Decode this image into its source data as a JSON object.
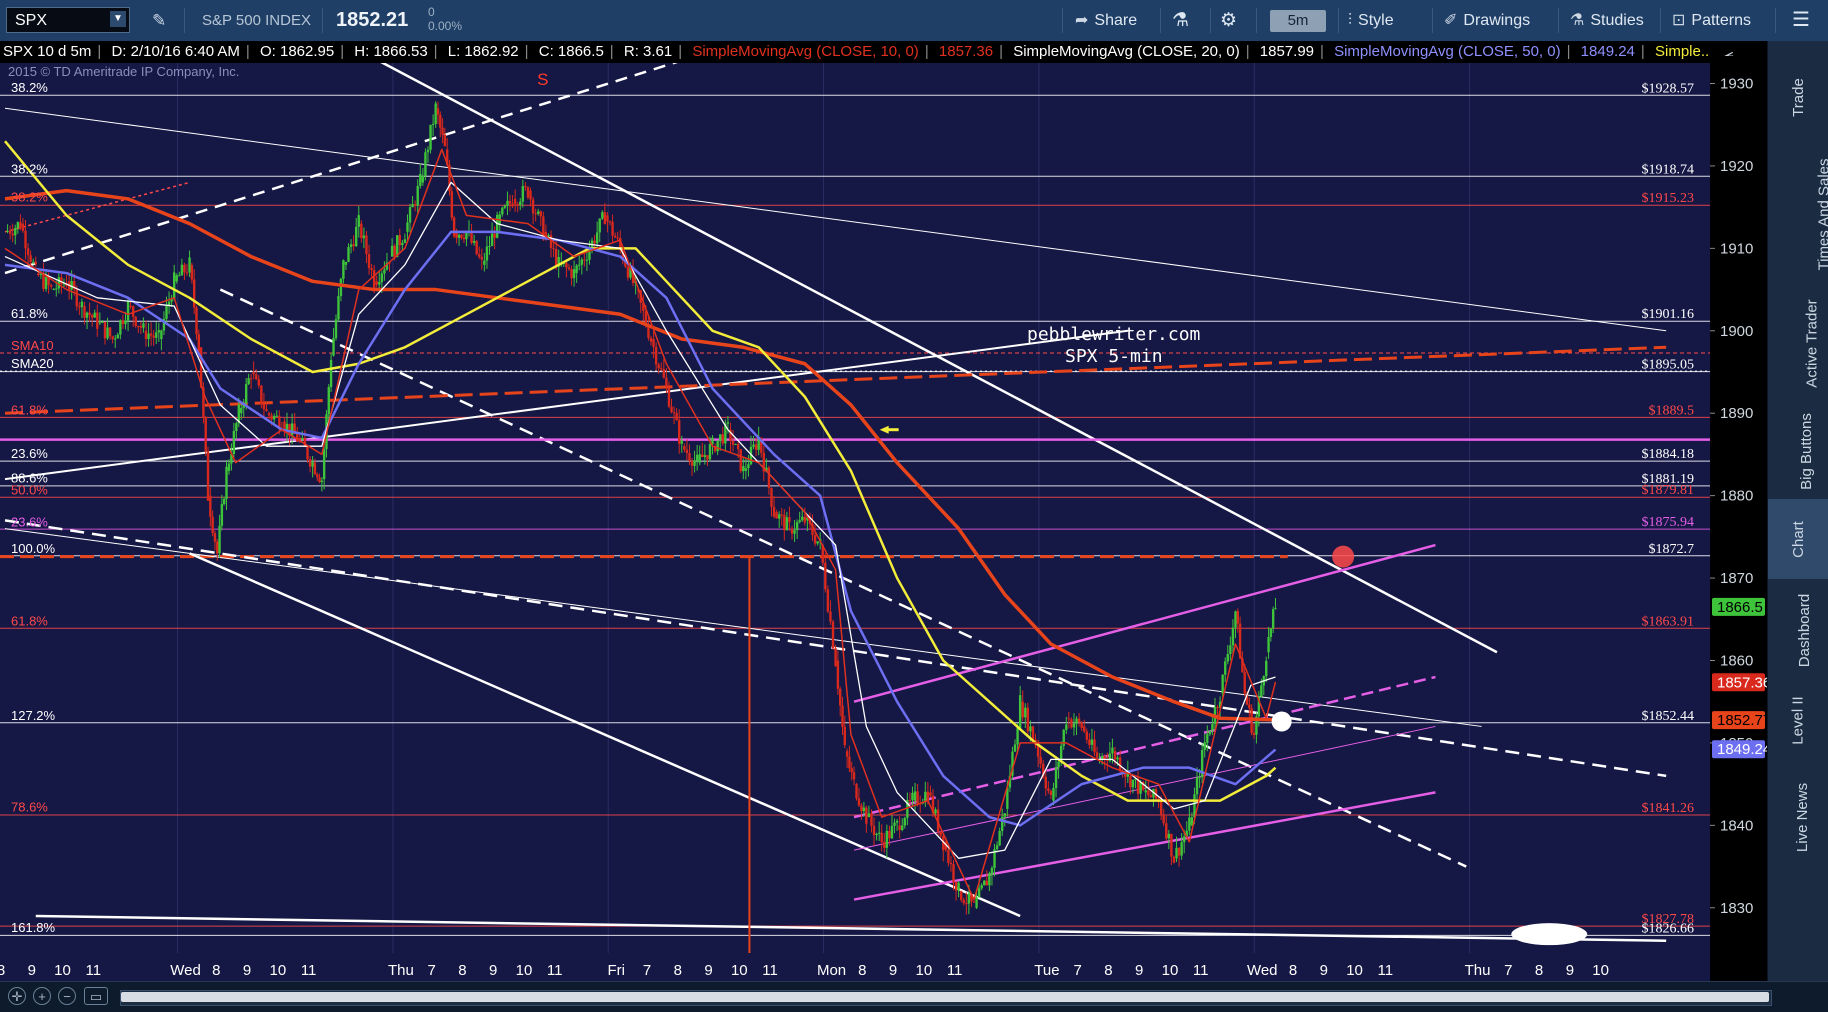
{
  "toolbar": {
    "symbol": "SPX",
    "description": "S&P 500 INDEX",
    "last_price": "1852.21",
    "change": "0",
    "change_pct": "0.00%",
    "share": "Share",
    "timeframe": "5m",
    "style": "Style",
    "drawings": "Drawings",
    "studies": "Studies",
    "patterns": "Patterns"
  },
  "status": {
    "chart_id": "SPX 10 d 5m",
    "date": "D: 2/10/16 6:40 AM",
    "open": "O: 1862.95",
    "high": "H: 1866.53",
    "low": "L: 1862.92",
    "close": "C: 1866.5",
    "range": "R: 3.61",
    "sma10_label": "SimpleMovingAvg (CLOSE, 10, 0)",
    "sma10_val": "1857.36",
    "sma20_label": "SimpleMovingAvg (CLOSE, 20, 0)",
    "sma20_val": "1857.99",
    "sma50_label": "SimpleMovingAvg (CLOSE, 50, 0)",
    "sma50_val": "1849.24",
    "more": "Simple..."
  },
  "colors": {
    "background": "#151744",
    "sma10": "#e0311f",
    "sma20": "#ffffff",
    "sma50": "#6d6ff2",
    "sma_yellow": "#f2ec3a",
    "magenta": "#e45ee6",
    "orange_red": "#e8441c",
    "up": "#3ec43a",
    "down": "#d9281c"
  },
  "chart": {
    "copyright": "2015 © TD Ameritrade IP Company, Inc.",
    "marker_s": "S",
    "watermark_1": "pebblewriter.com",
    "watermark_2": "SPX 5-min",
    "fib_labels": [
      {
        "text": "38.2%",
        "price": 1928.6,
        "color": "#ffffff"
      },
      {
        "text": "38.2%",
        "price": 1918.7,
        "color": "#ffffff"
      },
      {
        "text": "38.2%",
        "price": 1915.3,
        "color": "#ff4a4a"
      },
      {
        "text": "61.8%",
        "price": 1901.2,
        "color": "#ffffff"
      },
      {
        "text": "SMA10",
        "price": 1897.3,
        "color": "#ff4a4a"
      },
      {
        "text": "SMA20",
        "price": 1895.1,
        "color": "#ffffff"
      },
      {
        "text": "61.8%",
        "price": 1889.5,
        "color": "#ff4a4a"
      },
      {
        "text": "23.6%",
        "price": 1884.2,
        "color": "#ffffff"
      },
      {
        "text": "88.6%",
        "price": 1881.2,
        "color": "#ffffff"
      },
      {
        "text": "50.0%",
        "price": 1879.8,
        "color": "#ff4a4a"
      },
      {
        "text": "23.6%",
        "price": 1875.9,
        "color": "#e45ee6"
      },
      {
        "text": "100.0%",
        "price": 1872.7,
        "color": "#ffffff"
      },
      {
        "text": "61.8%",
        "price": 1863.9,
        "color": "#ff4a4a"
      },
      {
        "text": "127.2%",
        "price": 1852.4,
        "color": "#ffffff"
      },
      {
        "text": "78.6%",
        "price": 1841.3,
        "color": "#ff4a4a"
      },
      {
        "text": "161.8%",
        "price": 1826.7,
        "color": "#ffffff"
      }
    ],
    "level_labels": [
      {
        "text": "$1928.57",
        "price": 1928.57,
        "color": "#ffffff"
      },
      {
        "text": "$1918.74",
        "price": 1918.74,
        "color": "#ffffff"
      },
      {
        "text": "$1915.23",
        "price": 1915.23,
        "color": "#ff4a4a"
      },
      {
        "text": "$1901.16",
        "price": 1901.16,
        "color": "#ffffff"
      },
      {
        "text": "$1895.05",
        "price": 1895.05,
        "color": "#ffffff"
      },
      {
        "text": "$1889.5",
        "price": 1889.5,
        "color": "#ff4a4a"
      },
      {
        "text": "$1884.18",
        "price": 1884.18,
        "color": "#ffffff"
      },
      {
        "text": "$1881.19",
        "price": 1881.19,
        "color": "#ffffff"
      },
      {
        "text": "$1879.81",
        "price": 1879.81,
        "color": "#ff4a4a"
      },
      {
        "text": "$1875.94",
        "price": 1875.94,
        "color": "#e45ee6"
      },
      {
        "text": "$1872.7",
        "price": 1872.7,
        "color": "#ffffff"
      },
      {
        "text": "$1863.91",
        "price": 1863.91,
        "color": "#ff4a4a"
      },
      {
        "text": "$1852.44",
        "price": 1852.44,
        "color": "#ffffff"
      },
      {
        "text": "$1841.26",
        "price": 1841.26,
        "color": "#ff4a4a"
      },
      {
        "text": "$1827.78",
        "price": 1827.78,
        "color": "#ff4a4a"
      },
      {
        "text": "$1826.66",
        "price": 1826.66,
        "color": "#ffffff"
      }
    ],
    "axis_badges": [
      {
        "text": "1866.5",
        "price": 1866.5,
        "bg": "#3ec43a",
        "fg": "#000000"
      },
      {
        "text": "1857.36",
        "price": 1857.36,
        "bg": "#d9281c",
        "fg": "#ffffff"
      },
      {
        "text": "1852.77",
        "price": 1852.77,
        "bg": "#e8441c",
        "fg": "#000000"
      },
      {
        "text": "1849.24",
        "price": 1849.24,
        "bg": "#6d6ff2",
        "fg": "#ffffff"
      }
    ],
    "time_labels": [
      {
        "t": 0,
        "text": "8"
      },
      {
        "t": 1,
        "text": "9"
      },
      {
        "t": 2,
        "text": "10"
      },
      {
        "t": 3,
        "text": "11"
      },
      {
        "t": 6,
        "text": "Wed"
      },
      {
        "t": 7,
        "text": "8"
      },
      {
        "t": 8,
        "text": "9"
      },
      {
        "t": 9,
        "text": "10"
      },
      {
        "t": 10,
        "text": "11"
      },
      {
        "t": 13,
        "text": "Thu"
      },
      {
        "t": 14,
        "text": "7"
      },
      {
        "t": 15,
        "text": "8"
      },
      {
        "t": 16,
        "text": "9"
      },
      {
        "t": 17,
        "text": "10"
      },
      {
        "t": 18,
        "text": "11"
      },
      {
        "t": 20,
        "text": "Fri"
      },
      {
        "t": 21,
        "text": "7"
      },
      {
        "t": 22,
        "text": "8"
      },
      {
        "t": 23,
        "text": "9"
      },
      {
        "t": 24,
        "text": "10"
      },
      {
        "t": 25,
        "text": "11"
      },
      {
        "t": 27,
        "text": "Mon"
      },
      {
        "t": 28,
        "text": "8"
      },
      {
        "t": 29,
        "text": "9"
      },
      {
        "t": 30,
        "text": "10"
      },
      {
        "t": 31,
        "text": "11"
      },
      {
        "t": 34,
        "text": "Tue"
      },
      {
        "t": 35,
        "text": "7"
      },
      {
        "t": 36,
        "text": "8"
      },
      {
        "t": 37,
        "text": "9"
      },
      {
        "t": 38,
        "text": "10"
      },
      {
        "t": 39,
        "text": "11"
      },
      {
        "t": 41,
        "text": "Wed"
      },
      {
        "t": 42,
        "text": "8"
      },
      {
        "t": 43,
        "text": "9"
      },
      {
        "t": 44,
        "text": "10"
      },
      {
        "t": 45,
        "text": "11"
      },
      {
        "t": 48,
        "text": "Thu"
      },
      {
        "t": 49,
        "text": "7"
      },
      {
        "t": 50,
        "text": "8"
      },
      {
        "t": 51,
        "text": "9"
      },
      {
        "t": 52,
        "text": "10"
      }
    ]
  },
  "sidebar": {
    "tabs": [
      "Trade",
      "Times And Sales",
      "Active Trader",
      "Big Buttons",
      "Chart",
      "Dashboard",
      "Level II",
      "Live News"
    ],
    "active": "Chart"
  },
  "chart_data": {
    "type": "candlestick",
    "price_axis": {
      "min": 1825,
      "max": 1932,
      "ticks": [
        1830,
        1840,
        1850,
        1860,
        1870,
        1880,
        1890,
        1900,
        1910,
        1920,
        1930
      ]
    },
    "time_axis": {
      "unit": "hour-index",
      "min": 0,
      "max": 53
    },
    "close_path": [
      [
        0,
        1912
      ],
      [
        0.5,
        1913
      ],
      [
        1,
        1907
      ],
      [
        1.5,
        1905
      ],
      [
        2,
        1906
      ],
      [
        2.5,
        1903
      ],
      [
        3,
        1901
      ],
      [
        3.5,
        1899
      ],
      [
        4,
        1903
      ],
      [
        4.5,
        1900
      ],
      [
        5,
        1899
      ],
      [
        5.5,
        1906
      ],
      [
        6,
        1908
      ],
      [
        6.3,
        1898
      ],
      [
        6.6,
        1880
      ],
      [
        6.9,
        1873
      ],
      [
        7.2,
        1883
      ],
      [
        7.6,
        1890
      ],
      [
        8,
        1895
      ],
      [
        8.5,
        1890
      ],
      [
        9,
        1889
      ],
      [
        9.5,
        1887
      ],
      [
        10,
        1884
      ],
      [
        10.3,
        1882
      ],
      [
        10.6,
        1897
      ],
      [
        11,
        1908
      ],
      [
        11.5,
        1913
      ],
      [
        12,
        1906
      ],
      [
        12.5,
        1909
      ],
      [
        13,
        1912
      ],
      [
        13.5,
        1918
      ],
      [
        14,
        1927
      ],
      [
        14.3,
        1922
      ],
      [
        14.6,
        1912
      ],
      [
        15,
        1912
      ],
      [
        15.5,
        1908
      ],
      [
        16,
        1913
      ],
      [
        16.5,
        1916
      ],
      [
        17,
        1917
      ],
      [
        17.5,
        1912
      ],
      [
        18,
        1908
      ],
      [
        18.5,
        1907
      ],
      [
        19,
        1910
      ],
      [
        19.5,
        1914
      ],
      [
        20,
        1910
      ],
      [
        20.5,
        1905
      ],
      [
        21,
        1899
      ],
      [
        21.5,
        1893
      ],
      [
        22,
        1886
      ],
      [
        22.5,
        1884
      ],
      [
        23,
        1886
      ],
      [
        23.5,
        1888
      ],
      [
        24,
        1883
      ],
      [
        24.5,
        1887
      ],
      [
        25,
        1878
      ],
      [
        25.5,
        1876
      ],
      [
        26,
        1877
      ],
      [
        26.5,
        1874
      ],
      [
        27,
        1860
      ],
      [
        27.3,
        1849
      ],
      [
        27.6,
        1845
      ],
      [
        28,
        1841
      ],
      [
        28.5,
        1838
      ],
      [
        29,
        1840
      ],
      [
        29.5,
        1843
      ],
      [
        30,
        1844
      ],
      [
        30.5,
        1838
      ],
      [
        31,
        1832
      ],
      [
        31.5,
        1830
      ],
      [
        32,
        1834
      ],
      [
        32.5,
        1842
      ],
      [
        33,
        1855
      ],
      [
        33.5,
        1850
      ],
      [
        34,
        1843
      ],
      [
        34.5,
        1853
      ],
      [
        35,
        1852
      ],
      [
        35.5,
        1848
      ],
      [
        36,
        1849
      ],
      [
        36.5,
        1846
      ],
      [
        37,
        1844
      ],
      [
        37.5,
        1843
      ],
      [
        38,
        1836
      ],
      [
        38.5,
        1840
      ],
      [
        39,
        1850
      ],
      [
        39.5,
        1856
      ],
      [
        40,
        1866
      ],
      [
        40.3,
        1856
      ],
      [
        40.6,
        1851
      ],
      [
        41,
        1861
      ],
      [
        41.3,
        1866.5
      ]
    ],
    "sma10": [
      [
        0,
        1910
      ],
      [
        2,
        1905
      ],
      [
        4,
        1902
      ],
      [
        5.5,
        1904
      ],
      [
        6.5,
        1892
      ],
      [
        7.5,
        1884
      ],
      [
        9,
        1888
      ],
      [
        10.3,
        1885
      ],
      [
        11.5,
        1905
      ],
      [
        13,
        1910
      ],
      [
        14.2,
        1922
      ],
      [
        15,
        1914
      ],
      [
        17,
        1913
      ],
      [
        18.5,
        1909
      ],
      [
        20,
        1911
      ],
      [
        21.5,
        1896
      ],
      [
        23,
        1886
      ],
      [
        24.5,
        1884
      ],
      [
        26,
        1878
      ],
      [
        27,
        1871
      ],
      [
        27.5,
        1851
      ],
      [
        28.5,
        1841
      ],
      [
        30,
        1843
      ],
      [
        31.5,
        1831
      ],
      [
        33,
        1850
      ],
      [
        34.5,
        1850
      ],
      [
        36,
        1847
      ],
      [
        37.5,
        1845
      ],
      [
        38.5,
        1838
      ],
      [
        40,
        1862
      ],
      [
        41,
        1853
      ],
      [
        41.3,
        1857.4
      ]
    ],
    "sma20": [
      [
        0,
        1909
      ],
      [
        3,
        1904
      ],
      [
        5.5,
        1903
      ],
      [
        7,
        1891
      ],
      [
        8.5,
        1886
      ],
      [
        10.3,
        1886
      ],
      [
        11.5,
        1902
      ],
      [
        13,
        1908
      ],
      [
        14.5,
        1918
      ],
      [
        16,
        1913
      ],
      [
        18,
        1911
      ],
      [
        20,
        1910
      ],
      [
        21.5,
        1900
      ],
      [
        23.5,
        1888
      ],
      [
        25,
        1882
      ],
      [
        27,
        1874
      ],
      [
        28,
        1852
      ],
      [
        29,
        1844
      ],
      [
        31,
        1836
      ],
      [
        32.5,
        1837
      ],
      [
        34,
        1848
      ],
      [
        36,
        1848
      ],
      [
        38,
        1842
      ],
      [
        39,
        1843
      ],
      [
        40.5,
        1857
      ],
      [
        41.3,
        1858
      ]
    ],
    "sma50": [
      [
        0,
        1908
      ],
      [
        2,
        1907
      ],
      [
        4,
        1904
      ],
      [
        6,
        1899
      ],
      [
        7,
        1893
      ],
      [
        9,
        1888
      ],
      [
        10.3,
        1887
      ],
      [
        11.5,
        1896
      ],
      [
        13,
        1905
      ],
      [
        14.5,
        1912
      ],
      [
        16,
        1912
      ],
      [
        18,
        1911
      ],
      [
        20,
        1909
      ],
      [
        21.5,
        1904
      ],
      [
        23,
        1893
      ],
      [
        25,
        1885
      ],
      [
        26.5,
        1880
      ],
      [
        27.5,
        1866
      ],
      [
        29,
        1855
      ],
      [
        30.5,
        1846
      ],
      [
        32,
        1841
      ],
      [
        33,
        1840
      ],
      [
        35,
        1845
      ],
      [
        37,
        1847
      ],
      [
        38.5,
        1847
      ],
      [
        40,
        1845
      ],
      [
        41.3,
        1849.2
      ]
    ],
    "sma_yellow": [
      [
        0,
        1923
      ],
      [
        2,
        1914
      ],
      [
        4,
        1908
      ],
      [
        6,
        1904
      ],
      [
        8,
        1899
      ],
      [
        10,
        1895
      ],
      [
        11.5,
        1896
      ],
      [
        13,
        1898
      ],
      [
        15,
        1902
      ],
      [
        17,
        1906
      ],
      [
        19,
        1910
      ],
      [
        20.5,
        1910
      ],
      [
        21.5,
        1906
      ],
      [
        23,
        1900
      ],
      [
        24.5,
        1898
      ],
      [
        26,
        1892
      ],
      [
        27.5,
        1883
      ],
      [
        29,
        1870
      ],
      [
        30.5,
        1860
      ],
      [
        32,
        1855
      ],
      [
        33.5,
        1850
      ],
      [
        35,
        1846
      ],
      [
        36.5,
        1843
      ],
      [
        38,
        1843
      ],
      [
        39.5,
        1843
      ],
      [
        41,
        1846
      ],
      [
        41.3,
        1847
      ]
    ],
    "sma_red": [
      [
        0,
        1916
      ],
      [
        2,
        1917
      ],
      [
        4,
        1916
      ],
      [
        6,
        1913
      ],
      [
        8,
        1909
      ],
      [
        10,
        1906
      ],
      [
        12,
        1905
      ],
      [
        14,
        1905
      ],
      [
        16,
        1904
      ],
      [
        18,
        1903
      ],
      [
        20,
        1902
      ],
      [
        22,
        1899
      ],
      [
        24,
        1898
      ],
      [
        26,
        1896
      ],
      [
        27.5,
        1891
      ],
      [
        29,
        1884
      ],
      [
        31,
        1876
      ],
      [
        32.5,
        1868
      ],
      [
        34,
        1862
      ],
      [
        36,
        1858
      ],
      [
        38,
        1855
      ],
      [
        39.5,
        1853
      ],
      [
        41.3,
        1852.8
      ]
    ]
  }
}
